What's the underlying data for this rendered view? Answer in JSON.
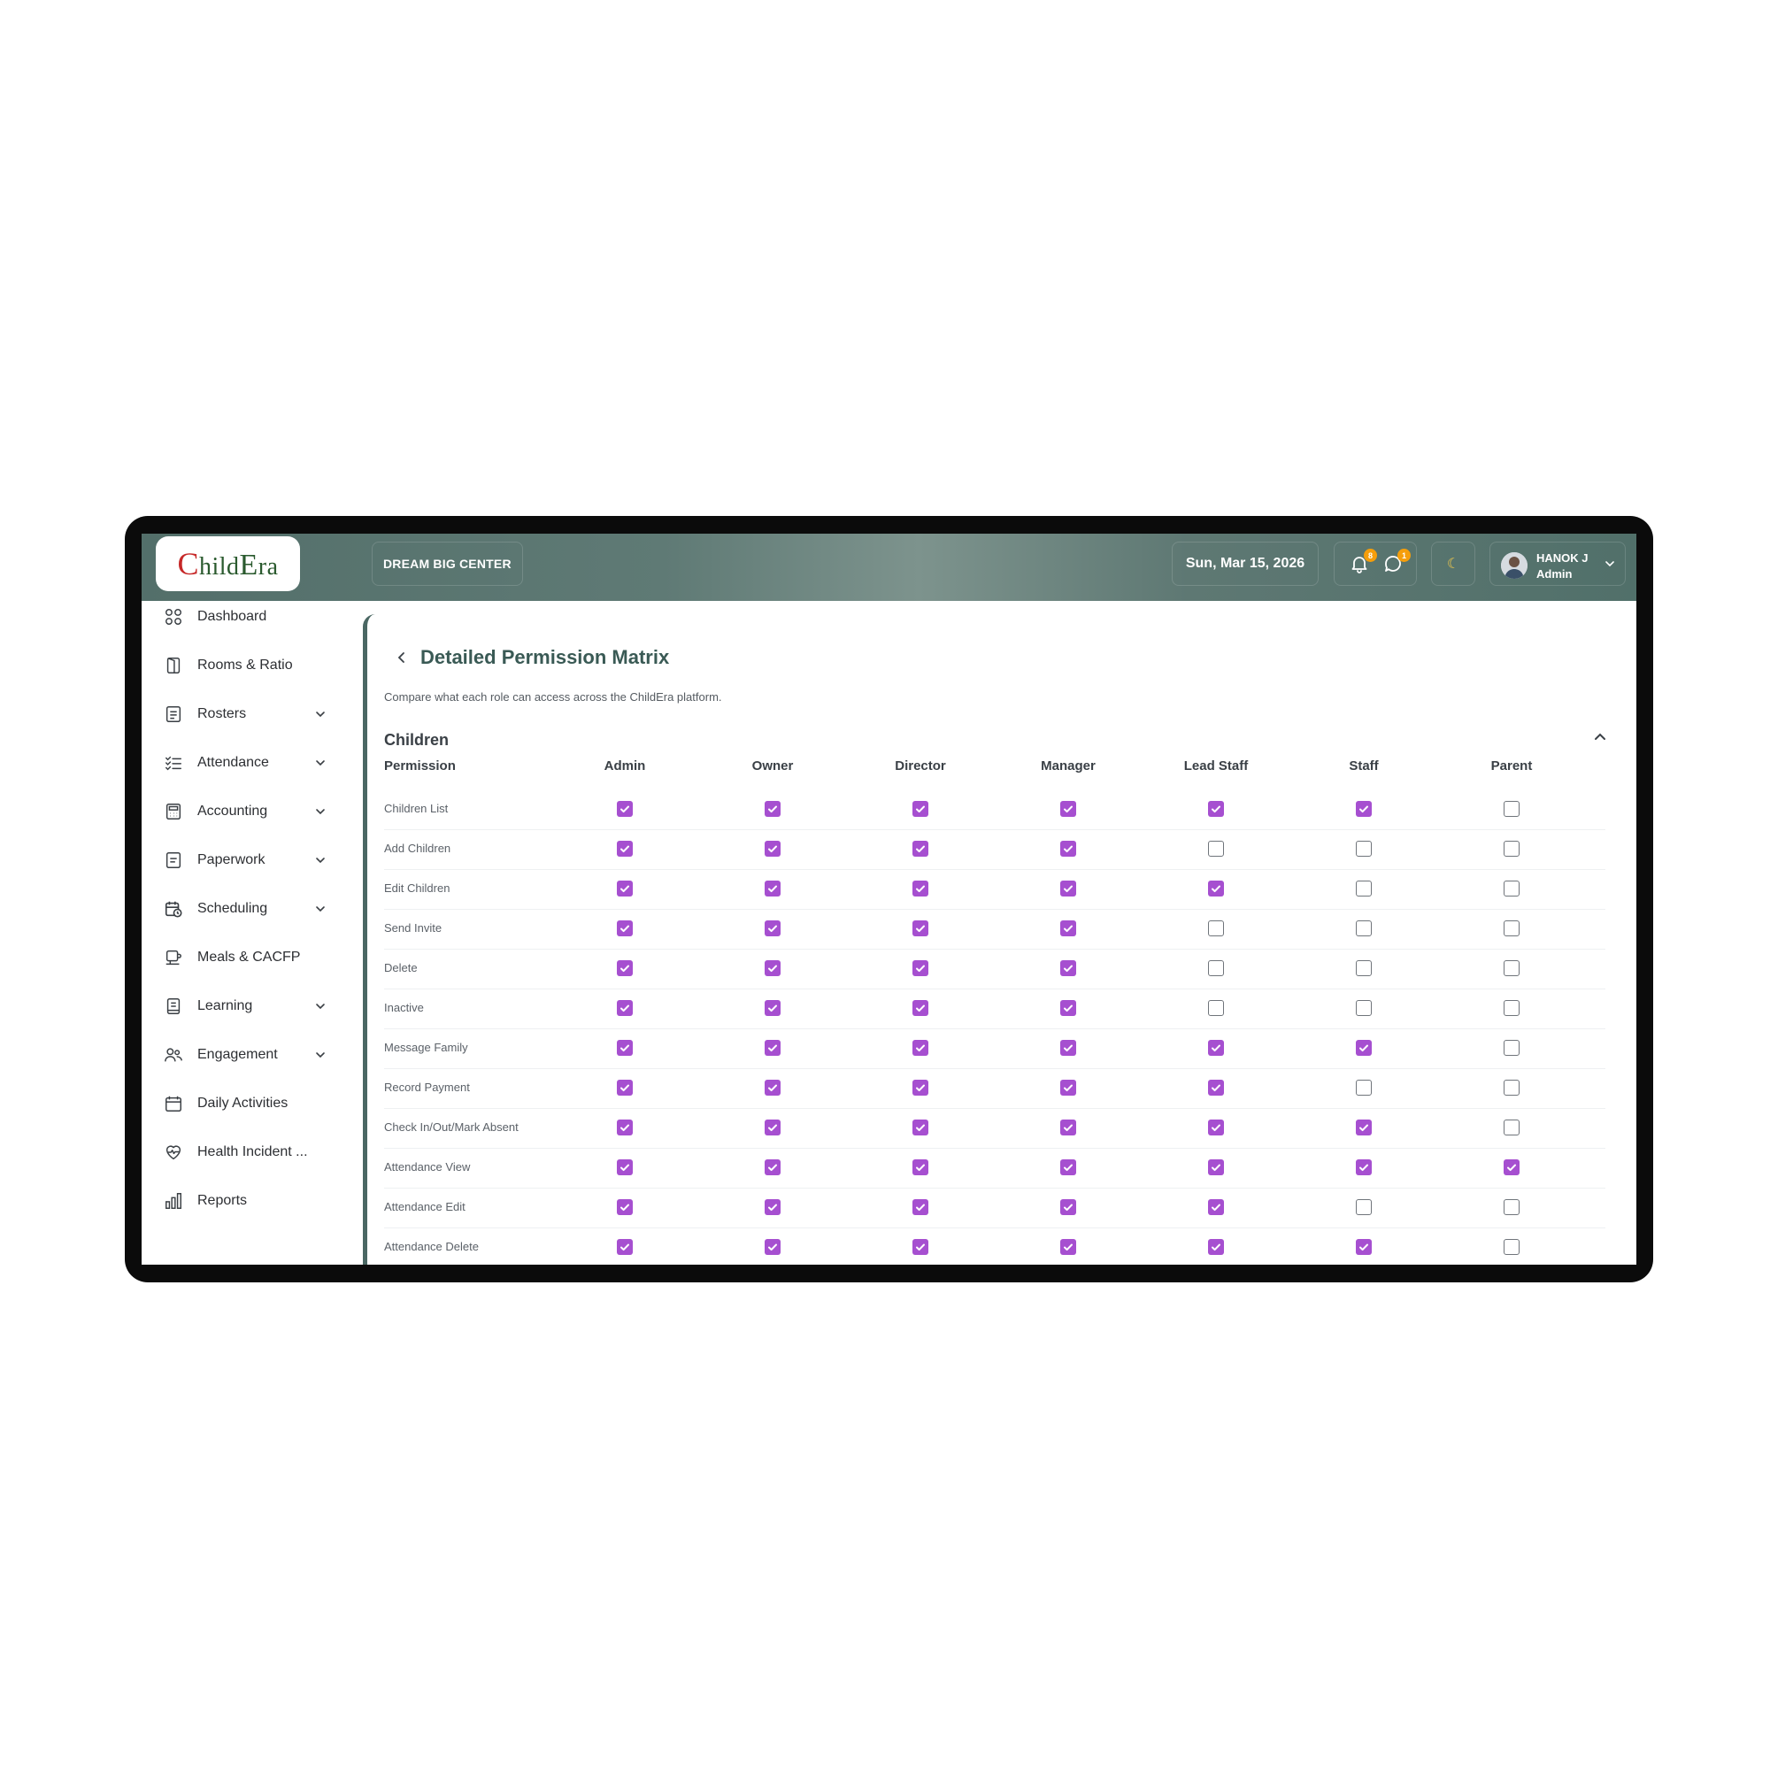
{
  "app": {
    "logo_text": "ChildEra"
  },
  "header": {
    "center_name": "DREAM BIG CENTER",
    "date": "Sun, Mar 15, 2026",
    "notifications_count": "8",
    "messages_count": "1",
    "user": {
      "name": "HANOK J",
      "role": "Admin"
    }
  },
  "sidebar": {
    "items": [
      {
        "label": "Dashboard",
        "icon": "grid-icon",
        "has_chevron": false
      },
      {
        "label": "Rooms & Ratio",
        "icon": "door-icon",
        "has_chevron": false
      },
      {
        "label": "Rosters",
        "icon": "roster-icon",
        "has_chevron": true
      },
      {
        "label": "Attendance",
        "icon": "checklist-icon",
        "has_chevron": true
      },
      {
        "label": "Accounting",
        "icon": "calculator-icon",
        "has_chevron": true
      },
      {
        "label": "Paperwork",
        "icon": "document-icon",
        "has_chevron": true
      },
      {
        "label": "Scheduling",
        "icon": "calendar-clock-icon",
        "has_chevron": true
      },
      {
        "label": "Meals & CACFP",
        "icon": "meal-icon",
        "has_chevron": false
      },
      {
        "label": "Learning",
        "icon": "book-icon",
        "has_chevron": true
      },
      {
        "label": "Engagement",
        "icon": "people-icon",
        "has_chevron": true
      },
      {
        "label": "Daily Activities",
        "icon": "calendar-icon",
        "has_chevron": false
      },
      {
        "label": "Health Incident ...",
        "icon": "heart-pulse-icon",
        "has_chevron": false
      },
      {
        "label": "Reports",
        "icon": "bar-chart-icon",
        "has_chevron": false
      }
    ]
  },
  "main": {
    "title": "Detailed Permission Matrix",
    "subtitle": "Compare what each role can access across the ChildEra platform.",
    "section": "Children",
    "permission_header": "Permission",
    "roles": [
      "Admin",
      "Owner",
      "Director",
      "Manager",
      "Lead Staff",
      "Staff",
      "Parent"
    ],
    "rows": [
      {
        "label": "Children List",
        "values": [
          true,
          true,
          true,
          true,
          true,
          true,
          false
        ]
      },
      {
        "label": "Add Children",
        "values": [
          true,
          true,
          true,
          true,
          false,
          false,
          false
        ]
      },
      {
        "label": "Edit Children",
        "values": [
          true,
          true,
          true,
          true,
          true,
          false,
          false
        ]
      },
      {
        "label": "Send Invite",
        "values": [
          true,
          true,
          true,
          true,
          false,
          false,
          false
        ]
      },
      {
        "label": "Delete",
        "values": [
          true,
          true,
          true,
          true,
          false,
          false,
          false
        ]
      },
      {
        "label": "Inactive",
        "values": [
          true,
          true,
          true,
          true,
          false,
          false,
          false
        ]
      },
      {
        "label": "Message Family",
        "values": [
          true,
          true,
          true,
          true,
          true,
          true,
          false
        ]
      },
      {
        "label": "Record Payment",
        "values": [
          true,
          true,
          true,
          true,
          true,
          false,
          false
        ]
      },
      {
        "label": "Check In/Out/Mark Absent",
        "values": [
          true,
          true,
          true,
          true,
          true,
          true,
          false
        ]
      },
      {
        "label": "Attendance View",
        "values": [
          true,
          true,
          true,
          true,
          true,
          true,
          true
        ]
      },
      {
        "label": "Attendance Edit",
        "values": [
          true,
          true,
          true,
          true,
          true,
          false,
          false
        ]
      },
      {
        "label": "Attendance Delete",
        "values": [
          true,
          true,
          true,
          true,
          true,
          true,
          false
        ]
      }
    ]
  },
  "colors": {
    "accent": "#a64fd0",
    "header_bg": "#5f7a75",
    "title": "#3a5a55",
    "badge": "#f59e0b"
  }
}
